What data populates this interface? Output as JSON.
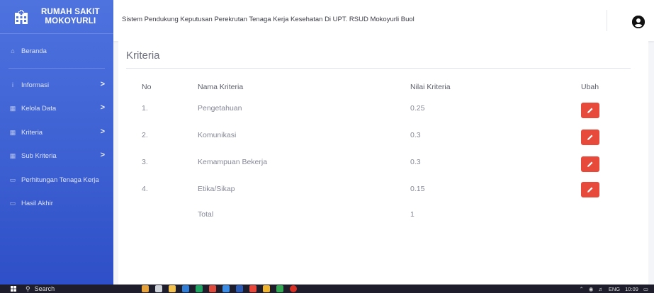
{
  "sidebar": {
    "brand": {
      "line1": "RUMAH SAKIT",
      "line2": "MOKOYURLI",
      "icon": "hospital-icon"
    },
    "items": [
      {
        "label": "Beranda",
        "icon": "home-icon",
        "chevron": ""
      },
      {
        "label": "Informasi",
        "icon": "info-icon",
        "chevron": ">"
      },
      {
        "label": "Kelola Data",
        "icon": "table-icon",
        "chevron": ">"
      },
      {
        "label": "Kriteria",
        "icon": "table-icon",
        "chevron": ">"
      },
      {
        "label": "Sub Kriteria",
        "icon": "table-icon",
        "chevron": ">"
      },
      {
        "label": "Perhitungan Tenaga Kerja",
        "icon": "laptop-icon",
        "chevron": ""
      },
      {
        "label": "Hasil Akhir",
        "icon": "laptop-icon",
        "chevron": ""
      }
    ]
  },
  "topbar": {
    "title": "Sistem Pendukung Keputusan Perekrutan Tenaga Kerja Kesehatan Di UPT. RSUD Mokoyurli Buol",
    "user_icon": "user-circle-icon"
  },
  "card": {
    "title": "Kriteria",
    "headers": {
      "no": "No",
      "name": "Nama Kriteria",
      "value": "Nilai Kriteria",
      "edit": "Ubah"
    },
    "rows": [
      {
        "no": "1.",
        "name": "Pengetahuan",
        "value": "0.25"
      },
      {
        "no": "2.",
        "name": "Komunikasi",
        "value": "0.3"
      },
      {
        "no": "3.",
        "name": "Kemampuan Bekerja",
        "value": "0.3"
      },
      {
        "no": "4.",
        "name": "Etika/Sikap",
        "value": "0.15"
      }
    ],
    "total": {
      "label": "Total",
      "value": "1"
    },
    "edit_icon": "pencil-icon"
  },
  "taskbar": {
    "search": "Search",
    "lang": "ENG",
    "time": "10:09"
  },
  "colors": {
    "sidebar": "#4e73df",
    "danger": "#e74a3b",
    "text_muted": "#858796"
  }
}
